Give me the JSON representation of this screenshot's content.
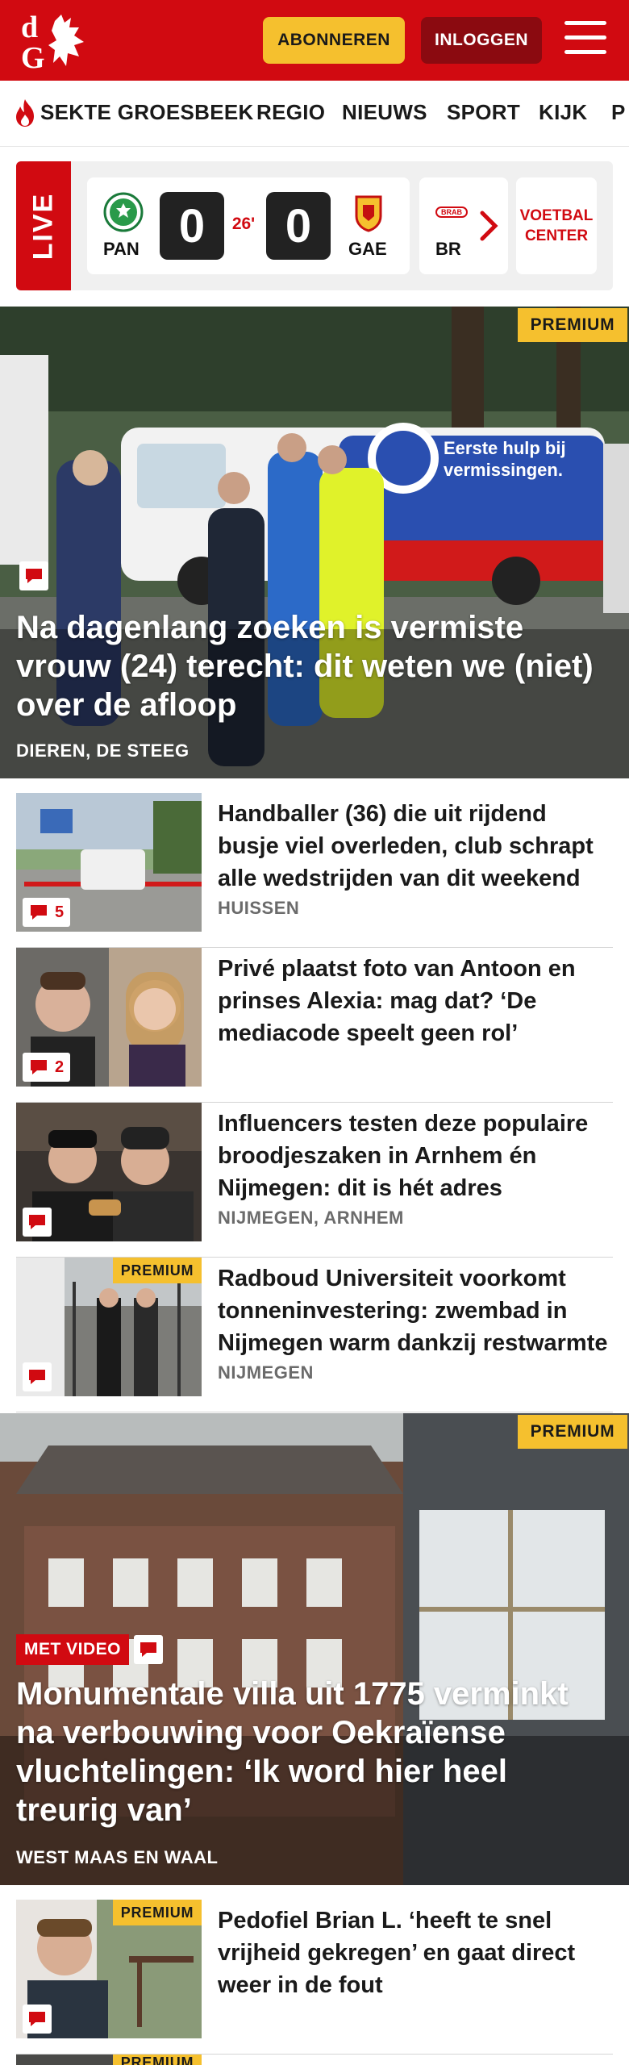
{
  "header": {
    "subscribe_label": "ABONNEREN",
    "login_label": "INLOGGEN",
    "brand_color": "#d10a11",
    "accent_color": "#f5c02e"
  },
  "nav": {
    "items": [
      "SEKTE GROESBEEK",
      "REGIO",
      "NIEUWS",
      "SPORT",
      "KIJK",
      "P"
    ]
  },
  "live": {
    "label": "LIVE",
    "match1": {
      "home": "PAN",
      "away": "GAE",
      "home_score": "0",
      "away_score": "0",
      "minute": "26'"
    },
    "match2": {
      "home": "BR",
      "home_logo_text": "BRAB"
    },
    "voetbal_center": "VOETBAL CENTER"
  },
  "hero": {
    "premium": "PREMIUM",
    "title": "Na dagenlang zoeken is vermiste vrouw (24) terecht: dit weten we (niet) over de afloop",
    "location": "DIEREN, DE STEEG",
    "van_text_1": "Eerste hulp bij",
    "van_text_2": "vermissingen."
  },
  "articles": [
    {
      "title": "Handballer (36) die uit rijdend busje viel overleden, club schrapt alle wedstrijden van dit weekend",
      "location": "HUISSEN",
      "comments": "5",
      "premium": ""
    },
    {
      "title": "Privé plaatst foto van Antoon en prinses Alexia: mag dat? ‘De mediacode speelt geen rol’",
      "location": "",
      "comments": "2",
      "premium": ""
    },
    {
      "title": "Influencers testen deze populaire broodjeszaken in Arnhem én Nijmegen: dit is hét adres",
      "location": "NIJMEGEN, ARNHEM",
      "comments": "",
      "premium": ""
    },
    {
      "title": "Radboud Universiteit voorkomt tonneninvestering: zwembad in Nijmegen warm dankzij restwarmte",
      "location": "NIJMEGEN",
      "comments": "",
      "premium": "PREMIUM"
    }
  ],
  "feature": {
    "premium": "PREMIUM",
    "video_label": "MET VIDEO",
    "title": "Monumentale villa uit 1775 verminkt na verbouwing voor Oekraïense vluchtelingen: ‘Ik word hier heel treurig van’",
    "location": "WEST MAAS EN WAAL"
  },
  "article5": {
    "premium": "PREMIUM",
    "title": "Pedofiel Brian L. ‘heeft te snel vrijheid gekregen’ en gaat direct weer in de fout"
  },
  "article6": {
    "premium": "PREMIUM"
  }
}
